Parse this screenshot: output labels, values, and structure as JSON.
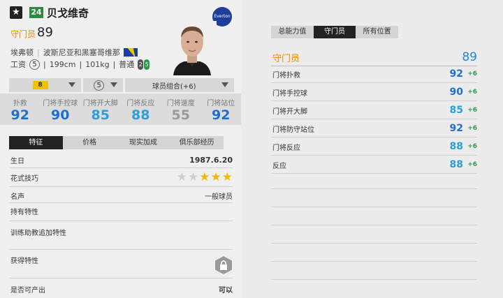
{
  "header": {
    "season_badge": "24",
    "player_name": "贝戈维奇",
    "position": "守门员",
    "overall": "89",
    "club": "埃弗顿",
    "nationality": "波斯尼亚和黑塞哥维那",
    "salary_label": "工资",
    "salary": "5",
    "height": "199cm",
    "weight": "101kg",
    "body_type": "普通",
    "weak_foot": "2",
    "strong_foot": "5",
    "club_crest_text": "Everton"
  },
  "selectors": {
    "level": "8",
    "training": "5",
    "combo": "球员组合(+6)"
  },
  "stats": [
    {
      "label": "扑救",
      "value": "92",
      "color": "#1e6fd0"
    },
    {
      "label": "门将手控球",
      "value": "90",
      "color": "#1e6fd0"
    },
    {
      "label": "门将开大脚",
      "value": "85",
      "color": "#2a9fd8"
    },
    {
      "label": "门将反应",
      "value": "88",
      "color": "#2a9fd8"
    },
    {
      "label": "门将速度",
      "value": "55",
      "color": "#999999"
    },
    {
      "label": "门将站位",
      "value": "92",
      "color": "#1e6fd0"
    }
  ],
  "left_tabs": [
    "特征",
    "价格",
    "现实加成",
    "俱乐部经历"
  ],
  "details": {
    "birthday_label": "生日",
    "birthday": "1987.6.20",
    "skill_label": "花式技巧",
    "skill_stars": 3,
    "reputation_label": "名声",
    "reputation": "一般球员",
    "traits_label": "持有特性",
    "coach_traits_label": "训练助教追加特性",
    "acquired_label": "获得特性",
    "sellable_label": "是否可产出",
    "sellable": "可以"
  },
  "right_tabs": [
    "总能力值",
    "守门员",
    "所有位置"
  ],
  "position_rating": {
    "title": "守门员",
    "value": "89",
    "rows": [
      {
        "name": "门将扑救",
        "value": "92",
        "bonus": "+6",
        "color": "#1e6fd0"
      },
      {
        "name": "门将手控球",
        "value": "90",
        "bonus": "+6",
        "color": "#1e6fd0"
      },
      {
        "name": "门将开大脚",
        "value": "85",
        "bonus": "+6",
        "color": "#2a9fd8"
      },
      {
        "name": "门将防守站位",
        "value": "92",
        "bonus": "+6",
        "color": "#1e6fd0"
      },
      {
        "name": "门将反应",
        "value": "88",
        "bonus": "+6",
        "color": "#2a9fd8"
      },
      {
        "name": "反应",
        "value": "88",
        "bonus": "+6",
        "color": "#2a9fd8"
      }
    ]
  }
}
